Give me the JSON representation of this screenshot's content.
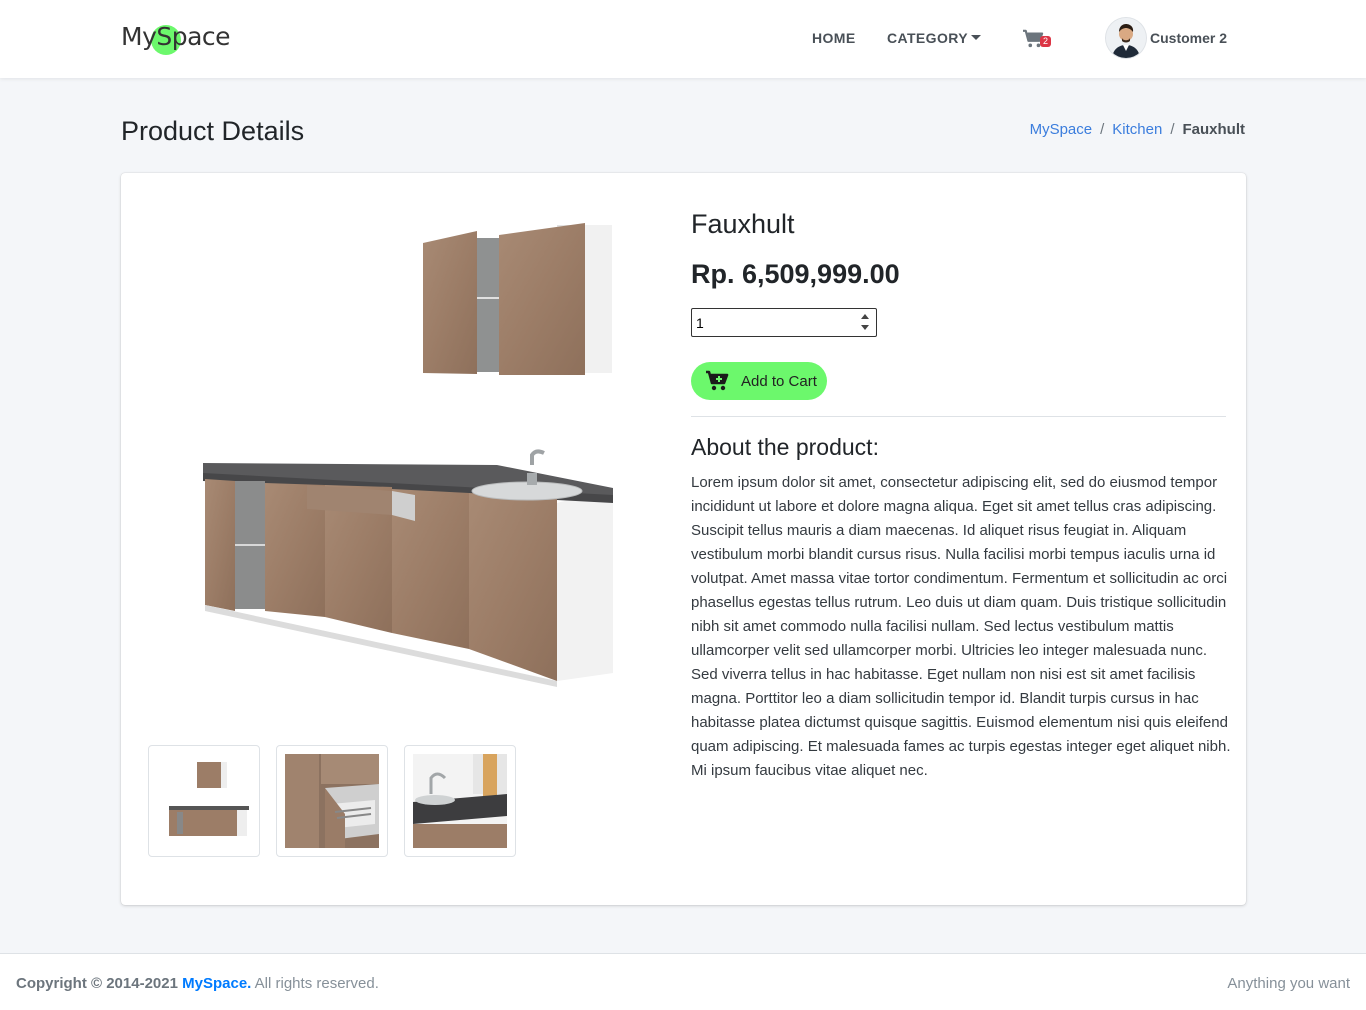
{
  "navbar": {
    "brand": "MySpace",
    "links": [
      {
        "label": "HOME"
      },
      {
        "label": "CATEGORY"
      }
    ],
    "cart_count": "2",
    "user_name": "Customer 2"
  },
  "header": {
    "title": "Product Details",
    "breadcrumb": [
      {
        "label": "MySpace"
      },
      {
        "label": "Kitchen"
      },
      {
        "label": "Fauxhult"
      }
    ]
  },
  "product": {
    "name": "Fauxhult",
    "price": "Rp. 6,509,999.00",
    "quantity": "1",
    "add_to_cart_label": "Add to Cart",
    "about_title": "About the product:",
    "about_text": "Lorem ipsum dolor sit amet, consectetur adipiscing elit, sed do eiusmod tempor incididunt ut labore et dolore magna aliqua. Eget sit amet tellus cras adipiscing. Suscipit tellus mauris a diam maecenas. Id aliquet risus feugiat in. Aliquam vestibulum morbi blandit cursus risus. Nulla facilisi morbi tempus iaculis urna id volutpat. Amet massa vitae tortor condimentum. Fermentum et sollicitudin ac orci phasellus egestas tellus rutrum. Leo duis ut diam quam. Duis tristique sollicitudin nibh sit amet commodo nulla facilisi nullam. Sed lectus vestibulum mattis ullamcorper velit sed ullamcorper morbi. Ultricies leo integer malesuada nunc. Sed viverra tellus in hac habitasse. Eget nullam non nisi est sit amet facilisis magna. Porttitor leo a diam sollicitudin tempor id. Blandit turpis cursus in hac habitasse platea dictumst quisque sagittis. Euismod elementum nisi quis eleifend quam adipiscing. Et malesuada fames ac turpis egestas integer eget aliquet nibh. Mi ipsum faucibus vitae aliquet nec.",
    "images": [
      {
        "icon": "kitchen-overview-image"
      },
      {
        "icon": "kitchen-drawer-image"
      },
      {
        "icon": "kitchen-sink-image"
      }
    ]
  },
  "footer": {
    "copyright_prefix": "Copyright © 2014-2021",
    "brand_link": "MySpace.",
    "rights": "All rights reserved.",
    "right_text": "Anything you want"
  },
  "colors": {
    "accent_green": "#6cf86c",
    "link_blue": "#3b7ddd",
    "badge_red": "#dc3545",
    "wood": "#a0826d"
  }
}
